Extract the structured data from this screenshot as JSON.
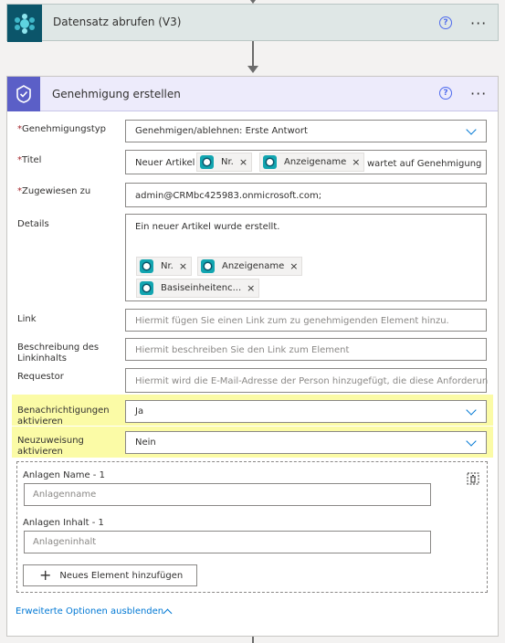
{
  "step1": {
    "title": "Datensatz abrufen (V3)",
    "icon": "dataverse-icon"
  },
  "step2": {
    "title": "Genehmigung erstellen",
    "icon": "approval-icon"
  },
  "help_label": "?",
  "more_label": "···",
  "fields": {
    "type": {
      "label": "Genehmigungstyp",
      "value": "Genehmigen/ablehnen: Erste Antwort"
    },
    "title": {
      "label": "Titel",
      "prefix": "Neuer Artikel",
      "tokens": [
        "Nr.",
        "Anzeigename"
      ],
      "suffix": "wartet auf Genehmigung"
    },
    "assigned": {
      "label": "Zugewiesen zu",
      "value": "admin@CRMbc425983.onmicrosoft.com;"
    },
    "details": {
      "label": "Details",
      "text": "Ein neuer Artikel wurde erstellt.",
      "tokens": [
        "Nr.",
        "Anzeigename",
        "Basiseinheitenc..."
      ]
    },
    "link": {
      "label": "Link",
      "placeholder": "Hiermit fügen Sie einen Link zum zu genehmigenden Element hinzu."
    },
    "link_desc": {
      "label": "Beschreibung des Linkinhalts",
      "placeholder": "Hiermit beschreiben Sie den Link zum Element"
    },
    "requestor": {
      "label": "Requestor",
      "placeholder": "Hiermit wird die E-Mail-Adresse der Person hinzugefügt, die diese Anforderun..."
    },
    "notifications": {
      "label": "Benachrichtigungen aktivieren",
      "value": "Ja"
    },
    "reassign": {
      "label": "Neuzuweisung aktivieren",
      "value": "Nein"
    }
  },
  "attachments": {
    "name_label": "Anlagen Name - 1",
    "name_placeholder": "Anlagenname",
    "content_label": "Anlagen Inhalt - 1",
    "content_placeholder": "Anlageninhalt",
    "add_button": "Neues Element hinzufügen"
  },
  "advanced_link": "Erweiterte Optionen ausblenden",
  "colors": {
    "accent": "#0078d4",
    "highlight": "#fbfba6",
    "approval": "#5b5fc7",
    "dataverse": "#0b556a"
  }
}
